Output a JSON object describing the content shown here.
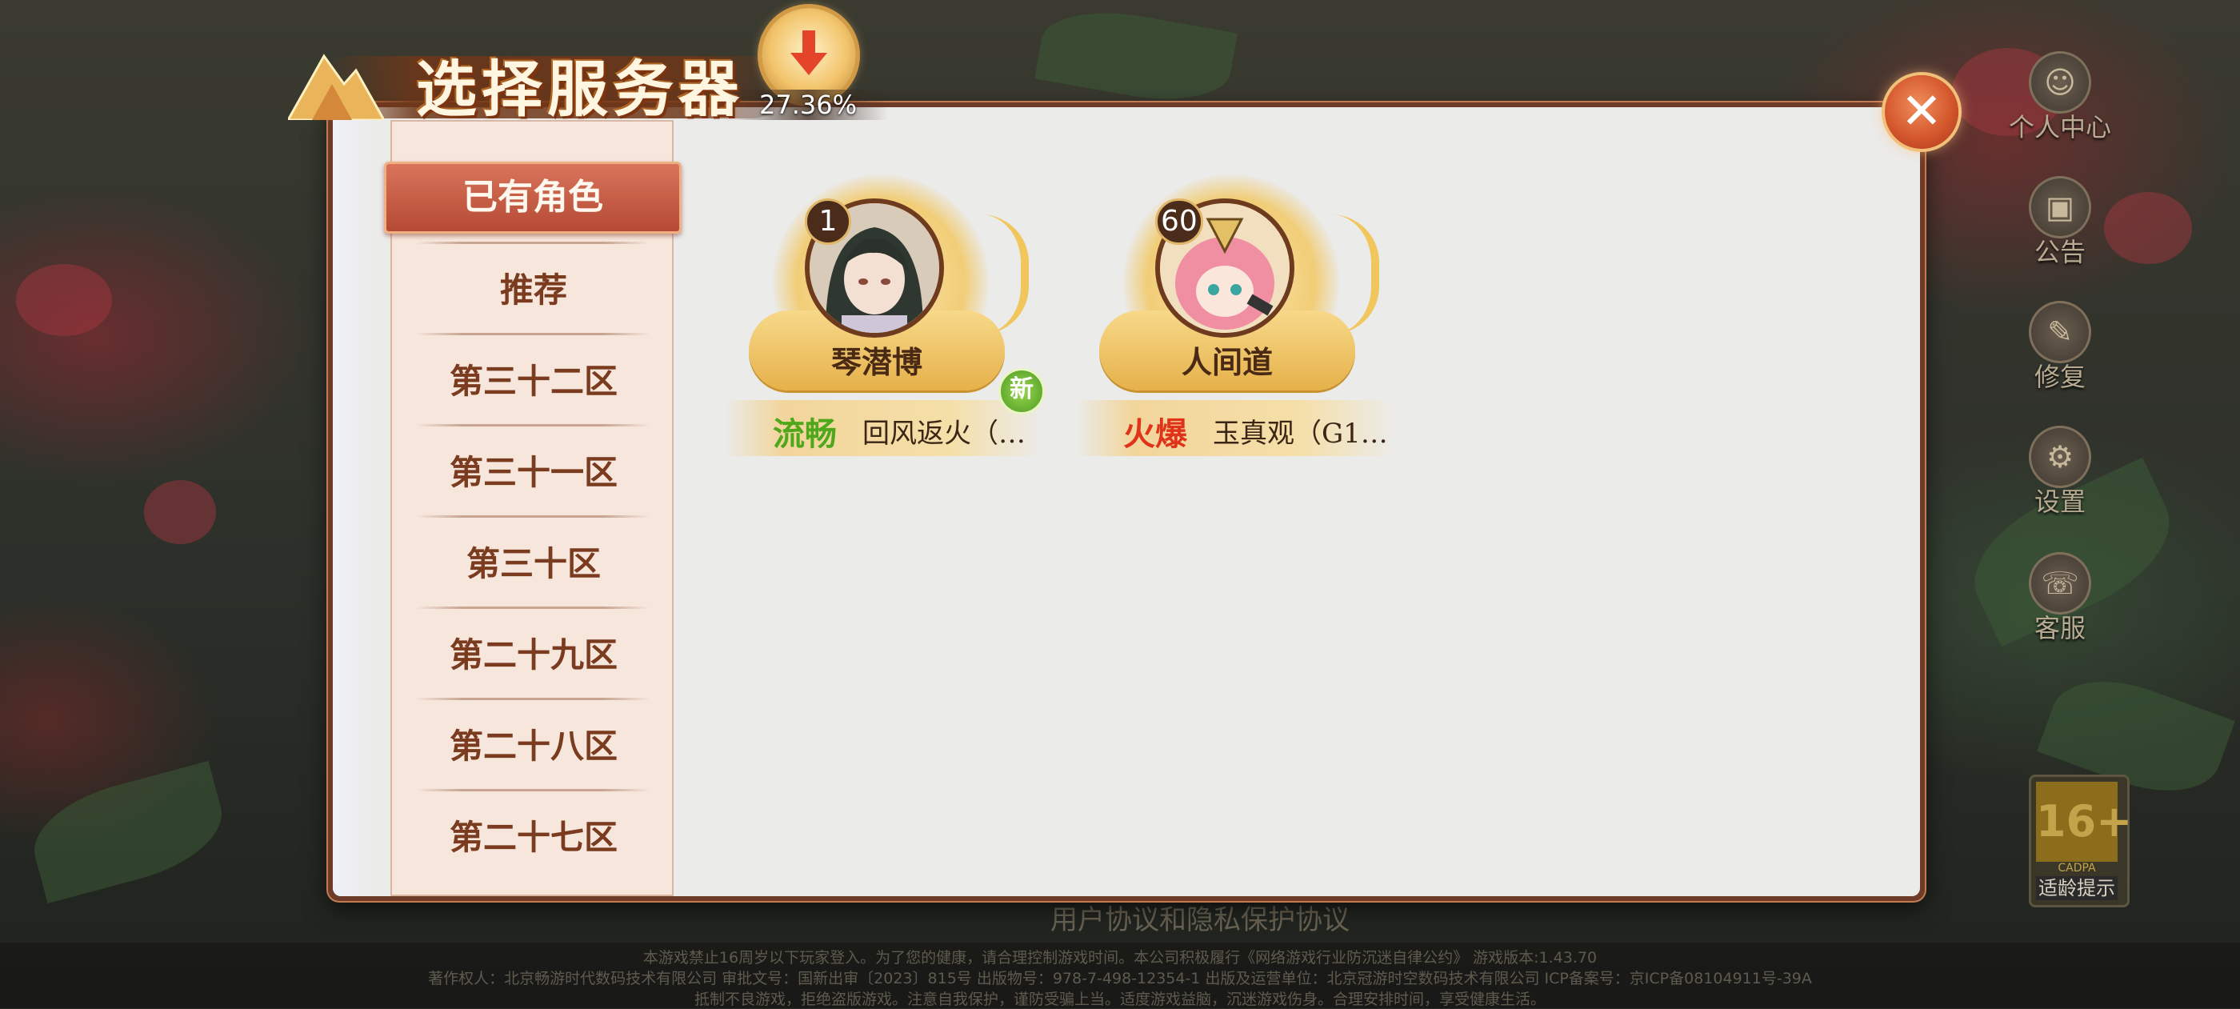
{
  "title": "选择服务器",
  "download": {
    "percent": "27.36%"
  },
  "side_menu": [
    {
      "label": "个人中心",
      "icon": "user-center-icon"
    },
    {
      "label": "公告",
      "icon": "announcement-icon"
    },
    {
      "label": "修复",
      "icon": "repair-icon"
    },
    {
      "label": "设置",
      "icon": "settings-icon"
    },
    {
      "label": "客服",
      "icon": "customer-service-icon"
    }
  ],
  "age_rating": {
    "value": "16+",
    "sub": "CADPA",
    "label": "适龄提示"
  },
  "tabs": [
    {
      "label": "已有角色",
      "active": true
    },
    {
      "label": "推荐"
    },
    {
      "label": "第三十二区"
    },
    {
      "label": "第三十一区"
    },
    {
      "label": "第三十区"
    },
    {
      "label": "第二十九区"
    },
    {
      "label": "第二十八区"
    },
    {
      "label": "第二十七区"
    }
  ],
  "characters": [
    {
      "level": "1",
      "name": "琴潜博",
      "status": "流畅",
      "server": "回风返火（…",
      "badge": "新"
    },
    {
      "level": "60",
      "name": "人间道",
      "status": "火爆",
      "server": "玉真观（G1…"
    }
  ],
  "colors": {
    "status_smooth": "#4fa81c",
    "status_hot": "#e0341a",
    "accent": "#b54a34"
  },
  "footer": {
    "links": "用户协议和隐私保护协议",
    "line1": "本游戏禁止16周岁以下玩家登入。为了您的健康，请合理控制游戏时间。本公司积极履行《网络游戏行业防沉迷自律公约》 游戏版本:1.43.70",
    "line2": "著作权人：北京畅游时代数码技术有限公司 审批文号：国新出审〔2023〕815号 出版物号：978-7-498-12354-1 出版及运营单位：北京冠游时空数码技术有限公司 ICP备案号：京ICP备08104911号-39A",
    "line3": "抵制不良游戏，拒绝盗版游戏。注意自我保护，谨防受骗上当。适度游戏益脑，沉迷游戏伤身。合理安排时间，享受健康生活。"
  }
}
